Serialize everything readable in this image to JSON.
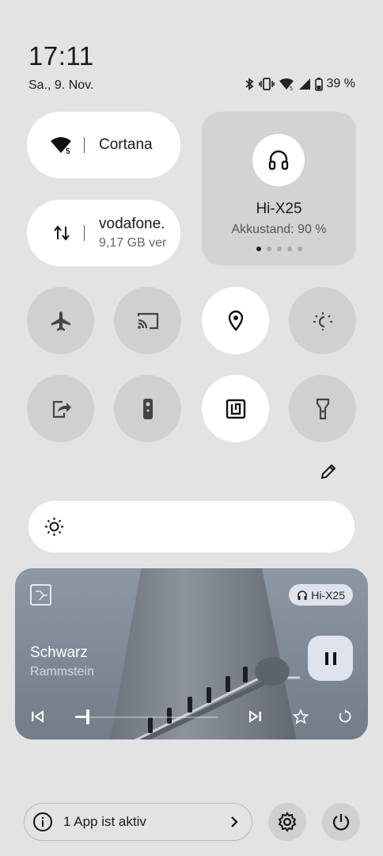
{
  "status_bar": {
    "time": "17:11",
    "date": "Sa., 9. Nov.",
    "battery_percent": "39 %",
    "icons": [
      "bluetooth-icon",
      "vibrate-icon",
      "wifi-5-icon",
      "cellular-signal-icon",
      "battery-icon"
    ]
  },
  "tiles": {
    "wifi": {
      "label": "Cortana",
      "badge": "5",
      "icon": "wifi-icon"
    },
    "mobile_data": {
      "label": "vodafone.",
      "sub": "9,17 GB ver",
      "icon": "data-transfer-icon"
    },
    "bluetooth_device": {
      "name": "Hi-X25",
      "battery": "Akkustand: 90 %",
      "icon": "headphones-icon",
      "page_index": 1,
      "page_count": 5
    }
  },
  "quick_settings": [
    {
      "id": "airplane",
      "icon": "airplane-icon",
      "active": false
    },
    {
      "id": "cast",
      "icon": "cast-icon",
      "active": false
    },
    {
      "id": "location",
      "icon": "location-icon",
      "active": true
    },
    {
      "id": "eye-comfort",
      "icon": "eye-comfort-icon",
      "active": false
    },
    {
      "id": "share",
      "icon": "share-icon",
      "active": false
    },
    {
      "id": "remote",
      "icon": "remote-icon",
      "active": false
    },
    {
      "id": "nfc",
      "icon": "nfc-icon",
      "active": true
    },
    {
      "id": "flashlight",
      "icon": "flashlight-icon",
      "active": false
    }
  ],
  "brightness": {
    "icon": "brightness-icon"
  },
  "media": {
    "song": "Schwarz",
    "artist": "Rammstein",
    "output_device": "Hi-X25",
    "state": "playing",
    "progress": 0.05
  },
  "footer": {
    "active_apps": "1 App ist aktiv",
    "colors": {
      "background": "#e3e3e3",
      "tile_off": "#d0d0d0",
      "tile_on": "#ffffff",
      "accent": "#dfe3ee"
    }
  }
}
